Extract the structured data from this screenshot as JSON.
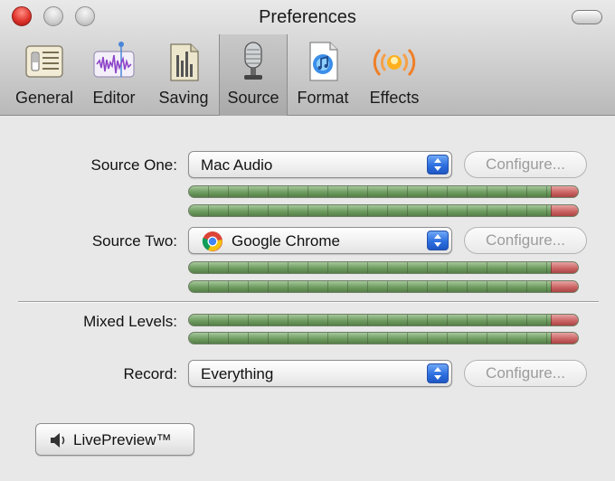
{
  "window": {
    "title": "Preferences"
  },
  "toolbar": {
    "tabs": [
      {
        "label": "General",
        "icon": "general-switch-icon"
      },
      {
        "label": "Editor",
        "icon": "waveform-icon"
      },
      {
        "label": "Saving",
        "icon": "file-cabinet-icon"
      },
      {
        "label": "Source",
        "icon": "microphone-icon",
        "selected": true
      },
      {
        "label": "Format",
        "icon": "music-document-icon"
      },
      {
        "label": "Effects",
        "icon": "broadcast-signal-icon"
      }
    ]
  },
  "sources": {
    "source_one": {
      "label": "Source One:",
      "value": "Mac Audio",
      "configure": "Configure..."
    },
    "source_two": {
      "label": "Source Two:",
      "value": "Google Chrome",
      "value_icon": "chrome-icon",
      "configure": "Configure..."
    },
    "mixed_levels": {
      "label": "Mixed Levels:"
    },
    "record": {
      "label": "Record:",
      "value": "Everything",
      "configure": "Configure..."
    }
  },
  "live_preview": {
    "label": "LivePreview™",
    "icon": "speaker-icon"
  },
  "colors": {
    "meter_green": "#6f9d61",
    "meter_peak": "#cc6666",
    "close_button": "#e0352d",
    "stepper_blue": "#2d6fe0"
  }
}
